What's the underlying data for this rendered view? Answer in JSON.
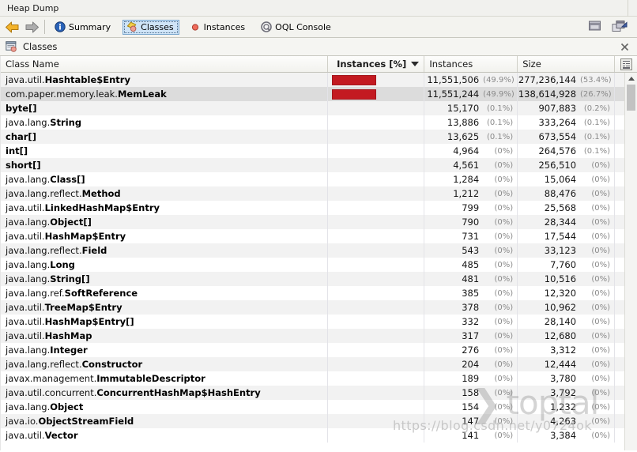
{
  "window": {
    "title": "Heap Dump"
  },
  "toolbar": {
    "back_label": "Back",
    "forward_label": "Forward",
    "tabs": [
      {
        "label": "Summary",
        "icon": "info-icon",
        "selected": false
      },
      {
        "label": "Classes",
        "icon": "classes-icon",
        "selected": true
      },
      {
        "label": "Instances",
        "icon": "instances-dot-icon",
        "selected": false
      },
      {
        "label": "OQL Console",
        "icon": "oql-console-icon",
        "selected": false
      }
    ],
    "right_buttons": [
      {
        "name": "window-layout-icon",
        "label": "Window"
      },
      {
        "name": "export-snapshot-icon",
        "label": "Export"
      }
    ]
  },
  "panel": {
    "title": "Classes",
    "icon": "classes-panel-icon",
    "close_label": "×"
  },
  "table": {
    "columns": [
      {
        "key": "class_name",
        "label": "Class Name",
        "sorted": false
      },
      {
        "key": "instances_pct_bar",
        "label": "Instances [%]",
        "sorted": true,
        "sort_dir": "desc"
      },
      {
        "key": "instances",
        "label": "Instances",
        "sorted": false
      },
      {
        "key": "size",
        "label": "Size",
        "sorted": false
      }
    ],
    "column_chooser_icon": "column-chooser-icon",
    "bar_color": "#c31a21",
    "selected_row_index": 1,
    "rows": [
      {
        "package": "java.util.",
        "class": "Hashtable$Entry",
        "bar_pct": 49.9,
        "instances": "11,551,506",
        "instances_pct": "(49.9%)",
        "size": "277,236,144",
        "size_pct": "(53.4%)"
      },
      {
        "package": "com.paper.memory.leak.",
        "class": "MemLeak",
        "bar_pct": 49.9,
        "instances": "11,551,244",
        "instances_pct": "(49.9%)",
        "size": "138,614,928",
        "size_pct": "(26.7%)"
      },
      {
        "package": "",
        "class": "byte[]",
        "bar_pct": 0,
        "instances": "15,170",
        "instances_pct": "(0.1%)",
        "size": "907,883",
        "size_pct": "(0.2%)"
      },
      {
        "package": "java.lang.",
        "class": "String",
        "bar_pct": 0,
        "instances": "13,886",
        "instances_pct": "(0.1%)",
        "size": "333,264",
        "size_pct": "(0.1%)"
      },
      {
        "package": "",
        "class": "char[]",
        "bar_pct": 0,
        "instances": "13,625",
        "instances_pct": "(0.1%)",
        "size": "673,554",
        "size_pct": "(0.1%)"
      },
      {
        "package": "",
        "class": "int[]",
        "bar_pct": 0,
        "instances": "4,964",
        "instances_pct": "(0%)",
        "size": "264,576",
        "size_pct": "(0.1%)"
      },
      {
        "package": "",
        "class": "short[]",
        "bar_pct": 0,
        "instances": "4,561",
        "instances_pct": "(0%)",
        "size": "256,510",
        "size_pct": "(0%)"
      },
      {
        "package": "java.lang.",
        "class": "Class[]",
        "bar_pct": 0,
        "instances": "1,284",
        "instances_pct": "(0%)",
        "size": "15,064",
        "size_pct": "(0%)"
      },
      {
        "package": "java.lang.reflect.",
        "class": "Method",
        "bar_pct": 0,
        "instances": "1,212",
        "instances_pct": "(0%)",
        "size": "88,476",
        "size_pct": "(0%)"
      },
      {
        "package": "java.util.",
        "class": "LinkedHashMap$Entry",
        "bar_pct": 0,
        "instances": "799",
        "instances_pct": "(0%)",
        "size": "25,568",
        "size_pct": "(0%)"
      },
      {
        "package": "java.lang.",
        "class": "Object[]",
        "bar_pct": 0,
        "instances": "790",
        "instances_pct": "(0%)",
        "size": "28,344",
        "size_pct": "(0%)"
      },
      {
        "package": "java.util.",
        "class": "HashMap$Entry",
        "bar_pct": 0,
        "instances": "731",
        "instances_pct": "(0%)",
        "size": "17,544",
        "size_pct": "(0%)"
      },
      {
        "package": "java.lang.reflect.",
        "class": "Field",
        "bar_pct": 0,
        "instances": "543",
        "instances_pct": "(0%)",
        "size": "33,123",
        "size_pct": "(0%)"
      },
      {
        "package": "java.lang.",
        "class": "Long",
        "bar_pct": 0,
        "instances": "485",
        "instances_pct": "(0%)",
        "size": "7,760",
        "size_pct": "(0%)"
      },
      {
        "package": "java.lang.",
        "class": "String[]",
        "bar_pct": 0,
        "instances": "481",
        "instances_pct": "(0%)",
        "size": "10,516",
        "size_pct": "(0%)"
      },
      {
        "package": "java.lang.ref.",
        "class": "SoftReference",
        "bar_pct": 0,
        "instances": "385",
        "instances_pct": "(0%)",
        "size": "12,320",
        "size_pct": "(0%)"
      },
      {
        "package": "java.util.",
        "class": "TreeMap$Entry",
        "bar_pct": 0,
        "instances": "378",
        "instances_pct": "(0%)",
        "size": "10,962",
        "size_pct": "(0%)"
      },
      {
        "package": "java.util.",
        "class": "HashMap$Entry[]",
        "bar_pct": 0,
        "instances": "332",
        "instances_pct": "(0%)",
        "size": "28,140",
        "size_pct": "(0%)"
      },
      {
        "package": "java.util.",
        "class": "HashMap",
        "bar_pct": 0,
        "instances": "317",
        "instances_pct": "(0%)",
        "size": "12,680",
        "size_pct": "(0%)"
      },
      {
        "package": "java.lang.",
        "class": "Integer",
        "bar_pct": 0,
        "instances": "276",
        "instances_pct": "(0%)",
        "size": "3,312",
        "size_pct": "(0%)"
      },
      {
        "package": "java.lang.reflect.",
        "class": "Constructor",
        "bar_pct": 0,
        "instances": "204",
        "instances_pct": "(0%)",
        "size": "12,444",
        "size_pct": "(0%)"
      },
      {
        "package": "javax.management.",
        "class": "ImmutableDescriptor",
        "bar_pct": 0,
        "instances": "189",
        "instances_pct": "(0%)",
        "size": "3,780",
        "size_pct": "(0%)"
      },
      {
        "package": "java.util.concurrent.",
        "class": "ConcurrentHashMap$HashEntry",
        "bar_pct": 0,
        "instances": "158",
        "instances_pct": "(0%)",
        "size": "3,792",
        "size_pct": "(0%)"
      },
      {
        "package": "java.lang.",
        "class": "Object",
        "bar_pct": 0,
        "instances": "154",
        "instances_pct": "(0%)",
        "size": "1,232",
        "size_pct": "(0%)"
      },
      {
        "package": "java.io.",
        "class": "ObjectStreamField",
        "bar_pct": 0,
        "instances": "147",
        "instances_pct": "(0%)",
        "size": "4,263",
        "size_pct": "(0%)"
      },
      {
        "package": "java.util.",
        "class": "Vector",
        "bar_pct": 0,
        "instances": "141",
        "instances_pct": "(0%)",
        "size": "3,384",
        "size_pct": "(0%)"
      }
    ]
  },
  "watermark": {
    "brand_chevron": "❯",
    "brand": "toptal",
    "url": "https://blog.csdn.net/y0724ok"
  }
}
